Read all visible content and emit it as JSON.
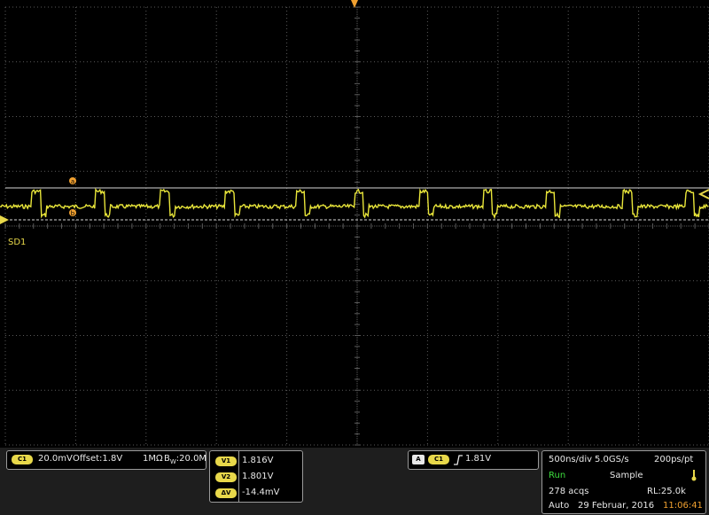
{
  "screen": {
    "channel_label": "SD1",
    "cursor_a_label": "a",
    "cursor_b_label": "b",
    "colors": {
      "trace": "#e8e53a",
      "grid": "#5a5a5a",
      "cursor": "#d9d9d9",
      "marker": "#f0a030",
      "background": "#000000"
    }
  },
  "channel_panel": {
    "tag": "C1",
    "scale": "20.0mV",
    "offset": "Offset:1.8V",
    "impedance": "1MΩ",
    "bandwidth_prefix": "B",
    "bandwidth_sub": "W",
    "bandwidth_value": ":20.0M"
  },
  "cursor_panel": {
    "v1_tag": "V1",
    "v1_value": "1.816V",
    "v2_tag": "V2",
    "v2_value": "1.801V",
    "dv_tag": "ΔV",
    "dv_value": "-14.4mV"
  },
  "trigger_panel": {
    "mode_tag": "A",
    "source_tag": "C1",
    "slope_icon": "rising-edge-icon",
    "level": "1.81V"
  },
  "acquisition_panel": {
    "timebase": "500ns/div",
    "sample_rate": "5.0GS/s",
    "resolution": "200ps/pt",
    "run_state": "Run",
    "acq_mode": "Sample",
    "acquisitions": "278 acqs",
    "record_length": "RL:25.0k",
    "trigger_mode": "Auto",
    "date": "29 Februar, 2016",
    "time": "11:06:41"
  }
}
